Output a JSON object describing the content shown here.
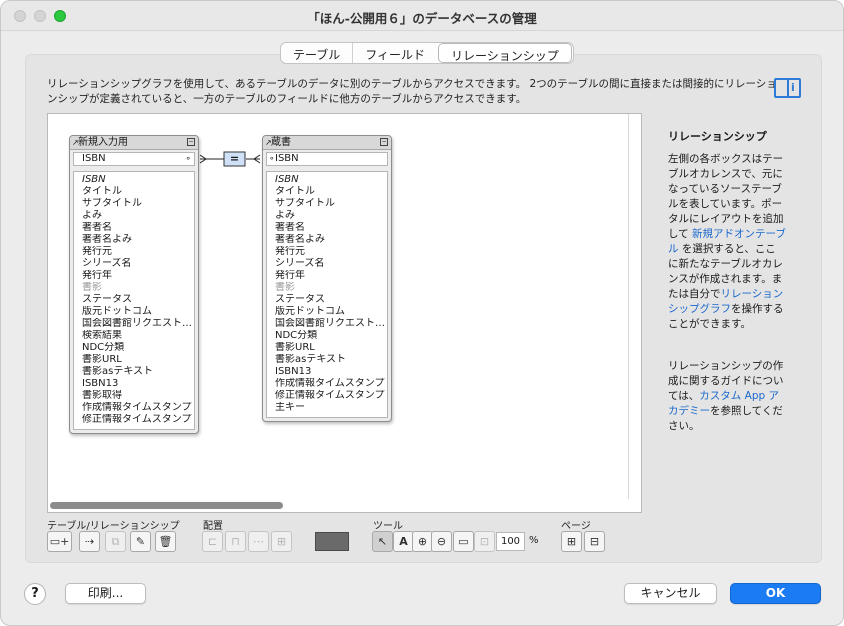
{
  "window": {
    "title": "「ほん-公開用６」のデータベースの管理"
  },
  "tabs": [
    {
      "label": "テーブル"
    },
    {
      "label": "フィールド"
    },
    {
      "label": "リレーションシップ"
    }
  ],
  "description": "リレーションシップグラフを使用して、あるテーブルのデータに別のテーブルからアクセスできます。 2つのテーブルの間に直接または間接的にリレーションシップが定義されていると、一方のテーブルのフィールドに他方のテーブルからアクセスできます。",
  "tables": [
    {
      "name": "新規入力用",
      "key": "ISBN",
      "fields": [
        "ISBN",
        "タイトル",
        "サブタイトル",
        "よみ",
        "著者名",
        "著者名よみ",
        "発行元",
        "シリーズ名",
        "発行年",
        "書影",
        "ステータス",
        "版元ドットコム",
        "国会図書館リクエスト…",
        "検索結果",
        "NDC分類",
        "書影URL",
        "書影asテキスト",
        "ISBN13",
        "書影取得",
        "作成情報タイムスタンプ",
        "修正情報タイムスタンプ"
      ]
    },
    {
      "name": "蔵書",
      "key": "ISBN",
      "fields": [
        "ISBN",
        "タイトル",
        "サブタイトル",
        "よみ",
        "著者名",
        "著者名よみ",
        "発行元",
        "シリーズ名",
        "発行年",
        "書影",
        "ステータス",
        "版元ドットコム",
        "国会図書館リクエスト…",
        "NDC分類",
        "書影URL",
        "書影asテキスト",
        "ISBN13",
        "作成情報タイムスタンプ",
        "修正情報タイムスタンプ",
        "主キー"
      ]
    }
  ],
  "relationship": {
    "operator": "="
  },
  "side_panel": {
    "title": "リレーションシップ",
    "p1_a": "左側の各ボックスはテーブルオカレンスで、元になっているソーステーブルを表しています。ポータルにレイアウトを追加して ",
    "p1_link1": "新規アドオンテーブル",
    "p1_b": " を選択すると、ここに新たなテーブルオカレンスが作成されます。または自分で",
    "p1_link2": "リレーションシップグラフ",
    "p1_c": "を操作することができます。",
    "p2_a": "リレーションシップの作成に関するガイドについては、",
    "p2_link": "カスタム App アカデミー",
    "p2_b": "を参照してください。"
  },
  "toolbar": {
    "group_tables": "テーブル/リレーションシップ",
    "group_arrange": "配置",
    "group_tools": "ツール",
    "group_page": "ページ",
    "zoom": "100",
    "zoom_unit": "%"
  },
  "footer": {
    "help": "?",
    "print": "印刷...",
    "cancel": "キャンセル",
    "ok": "OK"
  }
}
